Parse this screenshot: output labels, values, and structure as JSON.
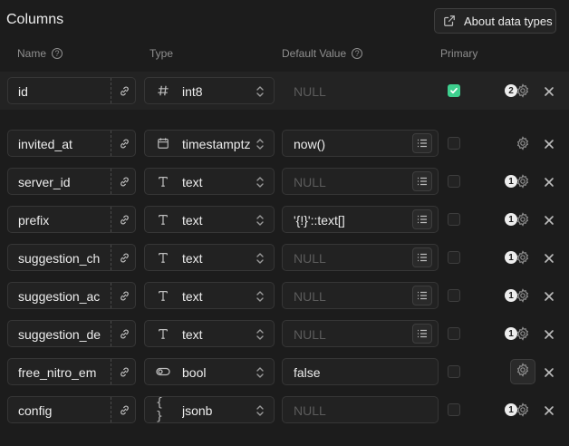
{
  "header": {
    "title": "Columns",
    "about_label": "About data types"
  },
  "table_headers": {
    "name": "Name",
    "type": "Type",
    "default": "Default Value",
    "primary": "Primary"
  },
  "colors": {
    "background": "#1c1c1c",
    "accent_green": "#3ecf8e",
    "placeholder": "#5c5c5c"
  },
  "rows": [
    {
      "name": "id",
      "type": "int8",
      "type_icon": "hash-icon",
      "default": "NULL",
      "default_is_placeholder": true,
      "has_list_button": false,
      "primary": true,
      "settings_count": "2"
    },
    {
      "name": "invited_at",
      "type": "timestamptz",
      "type_icon": "calendar-icon",
      "default": "now()",
      "default_is_placeholder": false,
      "has_list_button": true,
      "primary": false,
      "settings_count": ""
    },
    {
      "name": "server_id",
      "type": "text",
      "type_icon": "text-type-icon",
      "default": "NULL",
      "default_is_placeholder": true,
      "has_list_button": true,
      "primary": false,
      "settings_count": "1"
    },
    {
      "name": "prefix",
      "type": "text",
      "type_icon": "text-type-icon",
      "default": "'{!}'::text[]",
      "default_is_placeholder": false,
      "has_list_button": true,
      "primary": false,
      "settings_count": "1"
    },
    {
      "name": "suggestion_ch",
      "type": "text",
      "type_icon": "text-type-icon",
      "default": "NULL",
      "default_is_placeholder": true,
      "has_list_button": true,
      "primary": false,
      "settings_count": "1"
    },
    {
      "name": "suggestion_ac",
      "type": "text",
      "type_icon": "text-type-icon",
      "default": "NULL",
      "default_is_placeholder": true,
      "has_list_button": true,
      "primary": false,
      "settings_count": "1"
    },
    {
      "name": "suggestion_de",
      "type": "text",
      "type_icon": "text-type-icon",
      "default": "NULL",
      "default_is_placeholder": true,
      "has_list_button": true,
      "primary": false,
      "settings_count": "1"
    },
    {
      "name": "free_nitro_em",
      "type": "bool",
      "type_icon": "toggle-icon",
      "default": "false",
      "default_is_placeholder": false,
      "has_list_button": false,
      "primary": false,
      "settings_count": ""
    },
    {
      "name": "config",
      "type": "jsonb",
      "type_icon": "braces-icon",
      "default": "NULL",
      "default_is_placeholder": true,
      "has_list_button": false,
      "primary": false,
      "settings_count": "1"
    }
  ]
}
